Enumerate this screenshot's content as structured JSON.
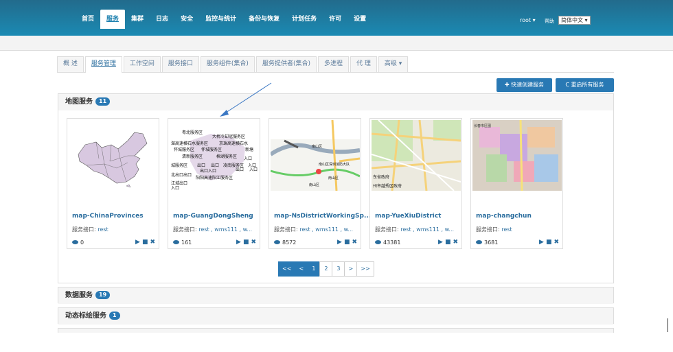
{
  "nav": {
    "items": [
      "首页",
      "服务",
      "集群",
      "日志",
      "安全",
      "监控与统计",
      "备份与恢复",
      "计划任务",
      "许可",
      "设置"
    ],
    "active_index": 1,
    "user": "root ▾",
    "help": "帮助",
    "lang": "简体中文 ▾"
  },
  "tabs": {
    "items": [
      "概 述",
      "服务管理",
      "工作空间",
      "服务接口",
      "服务组件(集合)",
      "服务提供者(集合)",
      "多进程",
      "代 理",
      "高级 ▾"
    ],
    "active_index": 1
  },
  "buttons": {
    "create": "✚ 快速创建服务",
    "restart": "C 重启所有服务"
  },
  "map_panel": {
    "title": "地图服务",
    "count": "11",
    "cards": [
      {
        "name": "map-ChinaProvinces",
        "iface_label": "服务接口:",
        "iface": "rest",
        "views": "0"
      },
      {
        "name": "map-GuangDongSheng",
        "iface_label": "服务接口:",
        "iface": "rest , wms111 , w...",
        "views": "161"
      },
      {
        "name": "map-NsDistrictWorkingSp...",
        "iface_label": "服务接口:",
        "iface": "rest , wms111 , w...",
        "views": "8572"
      },
      {
        "name": "map-YueXiuDistrict",
        "iface_label": "服务接口:",
        "iface": "rest , wms111 , w...",
        "views": "43381"
      },
      {
        "name": "map-changchun",
        "iface_label": "服务接口:",
        "iface": "rest",
        "views": "3681"
      }
    ],
    "thumb_labels": {
      "gd": [
        "粤北服务区",
        "大桥冷却冠服务区",
        "湛高速横石水服务区",
        "京珠高速横石水",
        "怀城服务区",
        "怀城服务区",
        "新塘",
        "清新服务区",
        "棉湖服务区",
        "入口",
        "城服务区",
        "出口",
        "出口",
        "凌南服务区",
        "入口",
        "出口入口",
        "出口",
        "入口",
        "北出口出口",
        "阳阳高速阳江服务区",
        "江城出口",
        "入口"
      ],
      "ns": [
        "南山区深圳消防大队",
        "南山区",
        "南山区",
        "南山区"
      ],
      "yx": [
        "东省政府",
        "州市越秀区政府"
      ],
      "cc": [
        "长春市区图"
      ]
    }
  },
  "pagination": [
    "<<",
    "<",
    "1",
    "2",
    "3",
    ">",
    ">>"
  ],
  "pagination_active": "1",
  "panels": [
    {
      "title": "数据服务",
      "count": "19"
    },
    {
      "title": "动态标绘服务",
      "count": "1"
    }
  ],
  "colors": {
    "topbar": "#1b8ab3",
    "accent": "#2979b4",
    "link": "#2a6d9e"
  }
}
